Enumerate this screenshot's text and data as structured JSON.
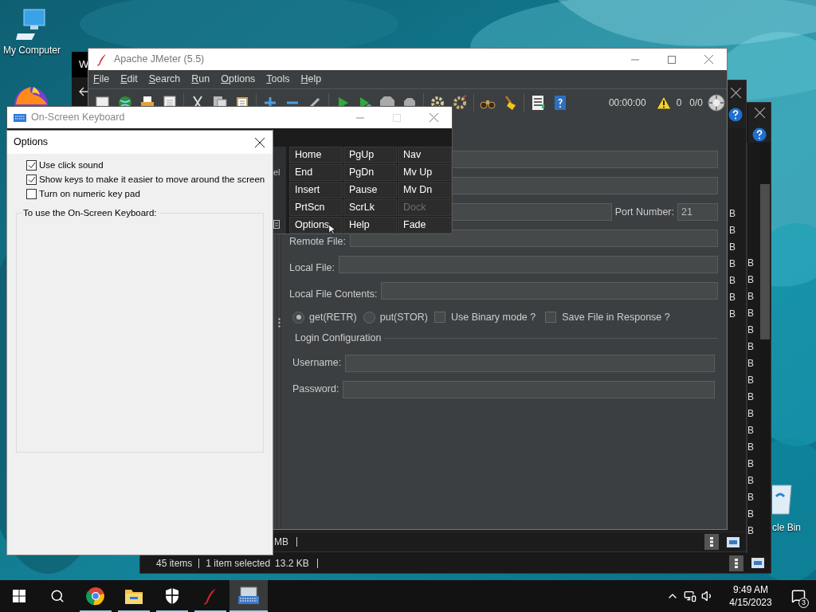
{
  "desktop": {
    "icons": [
      {
        "kind": "computer",
        "label": "My Computer"
      },
      {
        "kind": "recycle_bin",
        "label": "cle Bin"
      }
    ]
  },
  "explorer_windows": {
    "title": "W",
    "status_bar": {
      "count": "45 items",
      "selection": "1 item selected",
      "size": "13.2 KB"
    },
    "status_bar_back": "MB",
    "size_column": [
      "B",
      "B",
      "B",
      "B",
      "B",
      "B",
      "B"
    ],
    "column_b": [
      "B",
      "B",
      "B",
      "B",
      "B",
      "B",
      "B",
      "B",
      "B",
      "B",
      "B",
      "B",
      "B",
      "B",
      "B",
      "B",
      "B"
    ]
  },
  "jmeter": {
    "title": "Apache JMeter (5.5)",
    "menu": [
      "File",
      "Edit",
      "Search",
      "Run",
      "Options",
      "Tools",
      "Help"
    ],
    "toolbar_status": {
      "timer": "00:00:00",
      "warnings": "0",
      "threads": "0/0"
    },
    "tree_fragment": "el",
    "fields": [
      {
        "kind": "bare"
      },
      {
        "kind": "bare"
      },
      {
        "kind": "port",
        "label": "Port Number:",
        "value": "21"
      },
      {
        "kind": "labeled",
        "label": "Remote File:"
      },
      {
        "kind": "labeled",
        "label": "Local File:"
      },
      {
        "kind": "labeled",
        "label": "Local File Contents:"
      }
    ],
    "modes": [
      {
        "kind": "radio",
        "label": "get(RETR)",
        "selected": true
      },
      {
        "kind": "radio",
        "label": "put(STOR)",
        "selected": false
      },
      {
        "kind": "checkbox",
        "label": "Use Binary mode ?",
        "checked": false
      },
      {
        "kind": "checkbox",
        "label": "Save File in Response ?",
        "checked": false
      }
    ],
    "login": {
      "title": "Login Configuration",
      "fields": [
        {
          "label": "Username:"
        },
        {
          "label": "Password:"
        }
      ]
    }
  },
  "osk": {
    "title": "On-Screen Keyboard",
    "keys": [
      [
        {
          "label": "Home",
          "disabled": false
        },
        {
          "label": "PgUp",
          "disabled": false
        },
        {
          "label": "Nav",
          "disabled": false
        }
      ],
      [
        {
          "label": "End",
          "disabled": false
        },
        {
          "label": "PgDn",
          "disabled": false
        },
        {
          "label": "Mv Up",
          "disabled": false
        }
      ],
      [
        {
          "label": "Insert",
          "disabled": false
        },
        {
          "label": "Pause",
          "disabled": false
        },
        {
          "label": "Mv Dn",
          "disabled": false
        }
      ],
      [
        {
          "label": "PrtScn",
          "disabled": false
        },
        {
          "label": "ScrLk",
          "disabled": false
        },
        {
          "label": "Dock",
          "disabled": true
        }
      ],
      [
        {
          "label": "Options",
          "disabled": false
        },
        {
          "label": "Help",
          "disabled": false
        },
        {
          "label": "Fade",
          "disabled": false
        }
      ]
    ]
  },
  "options_dialog": {
    "title": "Options",
    "options": [
      {
        "label": "Use click sound",
        "checked": true
      },
      {
        "label": "Show keys to make it easier to move around the screen",
        "checked": true
      },
      {
        "label": "Turn on numeric key pad",
        "checked": false
      }
    ],
    "group_title": "To use the On-Screen Keyboard:"
  },
  "taskbar": {
    "apps": [
      {
        "kind": "browser",
        "running": true,
        "selected": false
      },
      {
        "kind": "files",
        "running": true,
        "selected": false
      },
      {
        "kind": "shield",
        "running": true,
        "selected": false
      },
      {
        "kind": "feather",
        "running": true,
        "selected": false
      },
      {
        "kind": "keyboard",
        "running": false,
        "selected": true
      }
    ],
    "time": "9:49 AM",
    "date": "4/15/2023",
    "notifications": "3"
  }
}
